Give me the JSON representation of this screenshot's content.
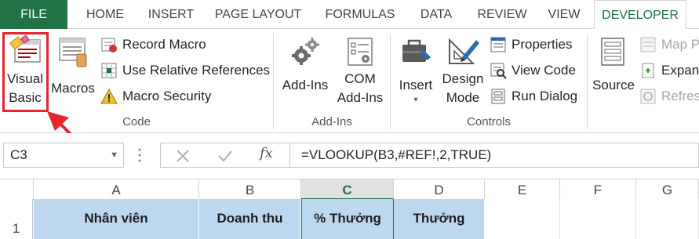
{
  "tabs": [
    "FILE",
    "HOME",
    "INSERT",
    "PAGE LAYOUT",
    "FORMULAS",
    "DATA",
    "REVIEW",
    "VIEW",
    "DEVELOPER"
  ],
  "active_tab": "DEVELOPER",
  "ribbon": {
    "code": {
      "label": "Code",
      "visual_basic": [
        "Visual",
        "Basic"
      ],
      "macros": "Macros",
      "record_macro": "Record Macro",
      "use_relative": "Use Relative References",
      "macro_security": "Macro Security"
    },
    "addins": {
      "label": "Add-Ins",
      "addins_btn": "Add-Ins",
      "com_addins": [
        "COM",
        "Add-Ins"
      ]
    },
    "controls": {
      "label": "Controls",
      "insert": "Insert",
      "design_mode": [
        "Design",
        "Mode"
      ],
      "properties": "Properties",
      "view_code": "View Code",
      "run_dialog": "Run Dialog"
    },
    "xml": {
      "source": "Source",
      "map_properties": "Map P",
      "expansion": "Expans",
      "refresh": "Refres"
    }
  },
  "formula_bar": {
    "name_box": "C3",
    "fx": "fx",
    "formula": "=VLOOKUP(B3,#REF!,2,TRUE)"
  },
  "grid": {
    "columns": [
      "A",
      "B",
      "C",
      "D",
      "E",
      "F",
      "G"
    ],
    "selected_column": "C",
    "row_number": "1",
    "headers": [
      "Nhân viên",
      "Doanh thu",
      "% Thưởng",
      "Thưởng"
    ]
  },
  "colors": {
    "excel_green": "#217346",
    "header_fill": "#bdd7ee",
    "highlight_red": "#e8242c"
  }
}
